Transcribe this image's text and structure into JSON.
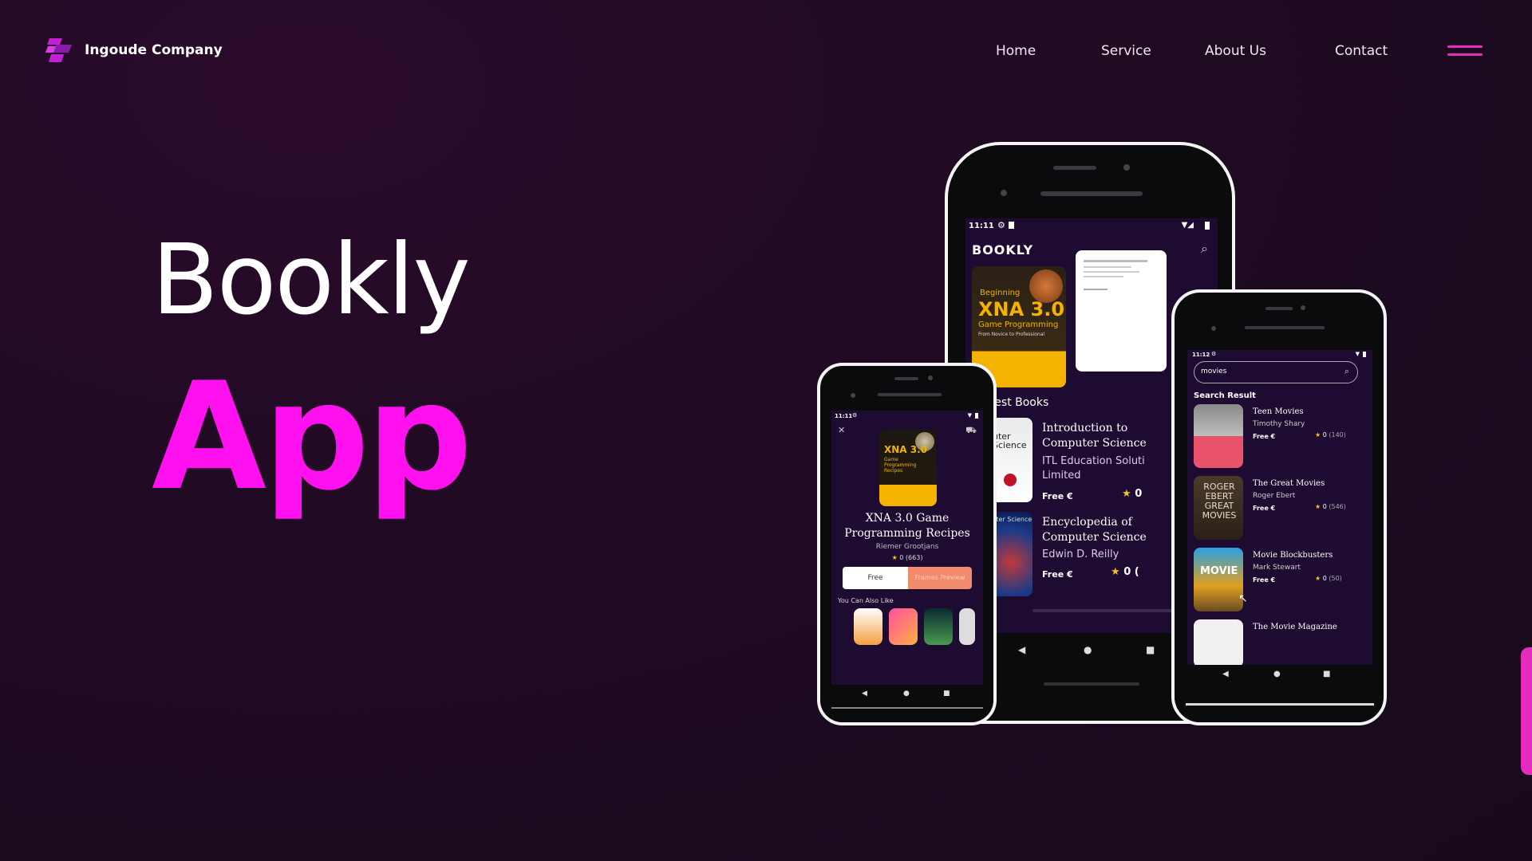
{
  "header": {
    "brand": "Ingoude Company",
    "nav": [
      "Home",
      "Service",
      "About Us",
      "Contact"
    ]
  },
  "hero": {
    "title": "Bookly",
    "accent": "App"
  },
  "colors": {
    "accent": "#ff10ee",
    "background": "#1f0a22"
  },
  "center_phone": {
    "time": "11:11",
    "app_logo": "BOOKLY",
    "cover_big_title": "XNA 3.0",
    "cover_big_prefix": "Beginning",
    "cover_big_sub": "Game Programming",
    "cover_big_tag": "From Novice to Professional",
    "section": "vest Books",
    "books": [
      {
        "title": "Introduction to Computer Science",
        "author": "ITL Education Soluti Limited",
        "price": "Free €",
        "rating": "0",
        "cover": "uter Science"
      },
      {
        "title": "Encyclopedia of Computer Science",
        "author": "Edwin D. Reilly",
        "price": "Free €",
        "rating": "0 (",
        "cover": "cter Science"
      }
    ]
  },
  "left_phone": {
    "time": "11:11",
    "cover_title": "XNA 3.0",
    "cover_sub": "Game Programming Recipes",
    "title": "XNA 3.0 Game Programming Recipes",
    "author": "Riemer Grootjans",
    "rating": "0",
    "rating_count": "(663)",
    "btn_free": "Free",
    "btn_preview": "Frames Preview",
    "also_like": "You Can Also Like"
  },
  "right_phone": {
    "time": "11:12",
    "search_value": "movies",
    "results_label": "Search Result",
    "results": [
      {
        "title": "Teen Movies",
        "author": "Timothy Shary",
        "price": "Free €",
        "rating": "0",
        "count": "(140)"
      },
      {
        "title": "The Great Movies",
        "author": "Roger Ebert",
        "price": "Free €",
        "rating": "0",
        "count": "(546)"
      },
      {
        "title": "Movie Blockbusters",
        "author": "Mark Stewart",
        "price": "Free €",
        "rating": "0",
        "count": "(50)"
      },
      {
        "title": "The Movie Magazine",
        "author": "",
        "price": "",
        "rating": "",
        "count": ""
      }
    ],
    "cover2_text": "ROGER EBERT GREAT MOVIES",
    "cover3_text": "MOVIE"
  },
  "icons": [
    "logo-icon",
    "menu-icon",
    "search-icon",
    "close-icon",
    "cart-icon",
    "star-icon",
    "back-icon",
    "home-icon",
    "recents-icon",
    "wifi-icon",
    "battery-icon",
    "gear-icon",
    "cursor-icon"
  ]
}
